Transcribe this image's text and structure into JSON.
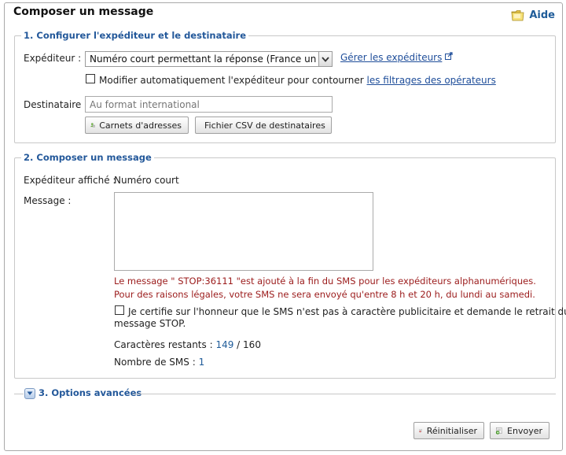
{
  "panel": {
    "title": "Composer un message",
    "help": "Aide"
  },
  "section1": {
    "legend": "1. Configurer l'expéditeur et le destinataire",
    "sender_label": "Expéditeur :",
    "sender_value": "Numéro court permettant la réponse (France uniquement)",
    "manage_link": "Gérer les expéditeurs",
    "auto_modify_text": "Modifier automatiquement l'expéditeur pour contourner",
    "auto_modify_link": "les filtrages des opérateurs",
    "recipient_label": "Destinataire :",
    "recipient_placeholder": "Au format international",
    "address_book_button": "Carnets d'adresses",
    "csv_button": "Fichier CSV de destinataires"
  },
  "section2": {
    "legend": "2. Composer un message",
    "displayed_sender_label": "Expéditeur affiché :",
    "displayed_sender_value": "Numéro court",
    "message_label": "Message :",
    "message_value": "",
    "stop_notice": "Le message \" STOP:36111 \"est ajouté à la fin du SMS pour les expéditeurs alphanumériques.",
    "legal_notice": "Pour des raisons légales, votre SMS ne sera envoyé qu'entre 8 h et 20 h, du lundi au samedi.",
    "certify_line1": "Je certifie sur l'honneur que le SMS n'est pas à caractère publicitaire et demande le retrait du",
    "certify_line2": "message STOP.",
    "chars_label": "Caractères restants :",
    "chars_remaining": "149",
    "chars_sep": "/",
    "chars_total": "160",
    "sms_count_label": "Nombre de SMS :",
    "sms_count": "1"
  },
  "section3": {
    "legend": "3. Options avancées"
  },
  "actions": {
    "reset": "Réinitialiser",
    "send": "Envoyer"
  },
  "colors": {
    "accent": "#23589a",
    "warning": "#9b1b1b",
    "link": "#1f4e9a"
  }
}
